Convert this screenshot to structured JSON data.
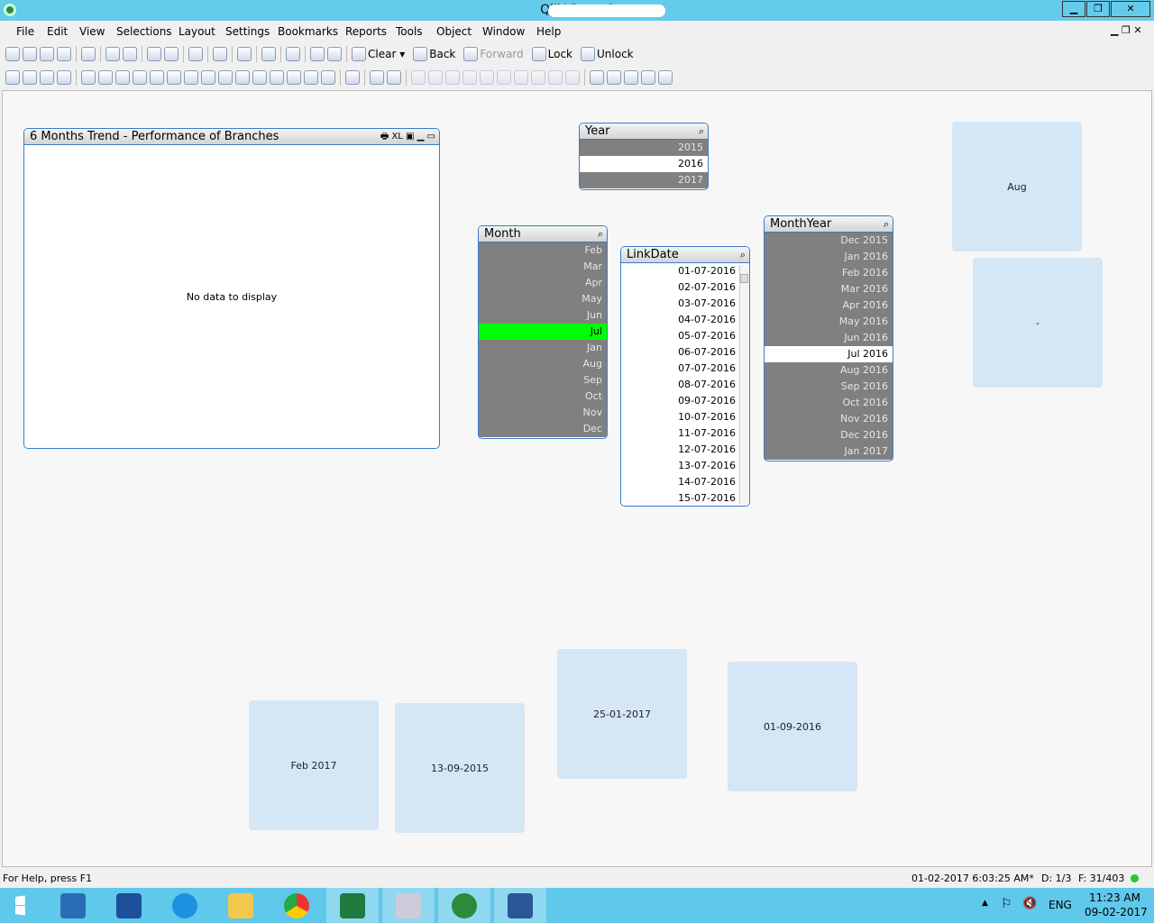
{
  "window": {
    "title": "QlikView x6",
    "minimize": "▁",
    "restore": "❐",
    "close": "✕"
  },
  "menu": [
    "File",
    "Edit",
    "View",
    "Selections",
    "Layout",
    "Settings",
    "Bookmarks",
    "Reports",
    "Tools",
    "Object",
    "Window",
    "Help"
  ],
  "toolbar1": {
    "clear": "Clear ▾",
    "back": "Back",
    "forward": "Forward",
    "lock": "Lock",
    "unlock": "Unlock"
  },
  "chart": {
    "title": "6 Months Trend - Performance of Branches",
    "xl": "XL",
    "empty": "No data to display"
  },
  "listboxes": {
    "year": {
      "title": "Year",
      "rows": [
        {
          "v": "2015",
          "s": "excluded"
        },
        {
          "v": "2016",
          "s": "possible"
        },
        {
          "v": "2017",
          "s": "excluded"
        }
      ]
    },
    "month": {
      "title": "Month",
      "rows": [
        {
          "v": "Feb",
          "s": "excluded"
        },
        {
          "v": "Mar",
          "s": "excluded"
        },
        {
          "v": "Apr",
          "s": "excluded"
        },
        {
          "v": "May",
          "s": "excluded"
        },
        {
          "v": "Jun",
          "s": "excluded"
        },
        {
          "v": "Jul",
          "s": "selected"
        },
        {
          "v": "Jan",
          "s": "excluded"
        },
        {
          "v": "Aug",
          "s": "excluded"
        },
        {
          "v": "Sep",
          "s": "excluded"
        },
        {
          "v": "Oct",
          "s": "excluded"
        },
        {
          "v": "Nov",
          "s": "excluded"
        },
        {
          "v": "Dec",
          "s": "excluded"
        }
      ]
    },
    "linkdate": {
      "title": "LinkDate",
      "rows": [
        {
          "v": "01-07-2016",
          "s": "possible"
        },
        {
          "v": "02-07-2016",
          "s": "possible"
        },
        {
          "v": "03-07-2016",
          "s": "possible"
        },
        {
          "v": "04-07-2016",
          "s": "possible"
        },
        {
          "v": "05-07-2016",
          "s": "possible"
        },
        {
          "v": "06-07-2016",
          "s": "possible"
        },
        {
          "v": "07-07-2016",
          "s": "possible"
        },
        {
          "v": "08-07-2016",
          "s": "possible"
        },
        {
          "v": "09-07-2016",
          "s": "possible"
        },
        {
          "v": "10-07-2016",
          "s": "possible"
        },
        {
          "v": "11-07-2016",
          "s": "possible"
        },
        {
          "v": "12-07-2016",
          "s": "possible"
        },
        {
          "v": "13-07-2016",
          "s": "possible"
        },
        {
          "v": "14-07-2016",
          "s": "possible"
        },
        {
          "v": "15-07-2016",
          "s": "possible"
        }
      ]
    },
    "monthyear": {
      "title": "MonthYear",
      "rows": [
        {
          "v": "Dec 2015",
          "s": "excluded"
        },
        {
          "v": "Jan 2016",
          "s": "excluded"
        },
        {
          "v": "Feb 2016",
          "s": "excluded"
        },
        {
          "v": "Mar 2016",
          "s": "excluded"
        },
        {
          "v": "Apr 2016",
          "s": "excluded"
        },
        {
          "v": "May 2016",
          "s": "excluded"
        },
        {
          "v": "Jun 2016",
          "s": "excluded"
        },
        {
          "v": "Jul 2016",
          "s": "possible"
        },
        {
          "v": "Aug 2016",
          "s": "excluded"
        },
        {
          "v": "Sep 2016",
          "s": "excluded"
        },
        {
          "v": "Oct 2016",
          "s": "excluded"
        },
        {
          "v": "Nov 2016",
          "s": "excluded"
        },
        {
          "v": "Dec 2016",
          "s": "excluded"
        },
        {
          "v": "Jan 2017",
          "s": "excluded"
        }
      ]
    }
  },
  "textobjects": {
    "t1": "Aug",
    "t2": "-",
    "t3": "Feb 2017",
    "t4": "13-09-2015",
    "t5": "25-01-2017",
    "t6": "01-09-2016"
  },
  "status": {
    "help": "For Help, press F1",
    "reload": "01-02-2017 6:03:25 AM*",
    "d": "D: 1/3",
    "f": "F: 31/403"
  },
  "taskbar": {
    "lang": "ENG",
    "time": "11:23 AM",
    "date": "09-02-2017"
  },
  "colors": {
    "selected": "#00ff00",
    "excluded": "#808080",
    "possible": "#ffffff",
    "titlebar": "#65cbeb"
  }
}
